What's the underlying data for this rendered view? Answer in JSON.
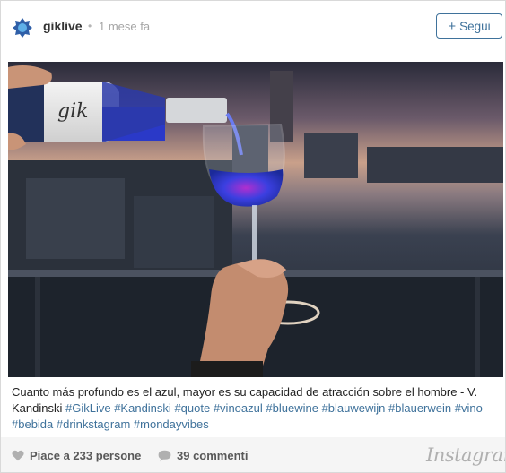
{
  "post": {
    "username": "giklive",
    "separator": "•",
    "time": "1 mese fa",
    "follow_label": "Segui",
    "caption": {
      "text": "Cuanto más profundo es el azul, mayor es su capacidad de atracción sobre el hombre - V. Kandinski",
      "hashtags": [
        "#GikLive",
        "#Kandinski",
        "#quote",
        "#vinoazul",
        "#bluewine",
        "#blauwewijn",
        "#blauerwein",
        "#vino",
        "#bebida",
        "#drinkstagram",
        "#mondayvibes"
      ]
    },
    "likes_label": "Piace a 233 persone",
    "comments_label": "39 commenti"
  },
  "brand": "Instagram",
  "colors": {
    "accent": "#3f729b",
    "wine": "#2d3fd6",
    "footer_bg": "#f5f5f5"
  },
  "icons": {
    "avatar": "gik-logo-icon",
    "follow": "plus-icon",
    "likes": "heart-icon",
    "comments": "speech-bubble-icon"
  }
}
